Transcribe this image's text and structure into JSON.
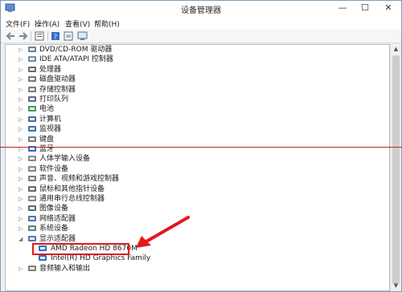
{
  "window": {
    "title": "设备管理器",
    "minimize": "—",
    "maximize": "☐",
    "close": "✕"
  },
  "menu": {
    "items": [
      {
        "label": "文件(F)"
      },
      {
        "label": "操作(A)"
      },
      {
        "label": "查看(V)"
      },
      {
        "label": "帮助(H)"
      }
    ]
  },
  "toolbar": {
    "icons": [
      "back-icon",
      "forward-icon",
      "properties-icon",
      "help-icon",
      "view-icon",
      "monitor-icon"
    ]
  },
  "tree": {
    "items": [
      {
        "label": "DVD/CD-ROM 驱动器",
        "expander": "▷",
        "icon": "dvd-drive-icon"
      },
      {
        "label": "IDE ATA/ATAPI 控制器",
        "expander": "▷",
        "icon": "ide-controller-icon"
      },
      {
        "label": "处理器",
        "expander": "▷",
        "icon": "processor-icon"
      },
      {
        "label": "磁盘驱动器",
        "expander": "▷",
        "icon": "disk-drive-icon"
      },
      {
        "label": "存储控制器",
        "expander": "▷",
        "icon": "storage-controller-icon"
      },
      {
        "label": "打印队列",
        "expander": "▷",
        "icon": "printer-icon"
      },
      {
        "label": "电池",
        "expander": "▷",
        "icon": "battery-icon"
      },
      {
        "label": "计算机",
        "expander": "▷",
        "icon": "computer-icon"
      },
      {
        "label": "监视器",
        "expander": "▷",
        "icon": "monitor-icon"
      },
      {
        "label": "键盘",
        "expander": "▷",
        "icon": "keyboard-icon"
      },
      {
        "label": "蓝牙",
        "expander": "▷",
        "icon": "bluetooth-icon"
      },
      {
        "label": "人体学输入设备",
        "expander": "▷",
        "icon": "hid-icon"
      },
      {
        "label": "软件设备",
        "expander": "▷",
        "icon": "software-device-icon"
      },
      {
        "label": "声音、视频和游戏控制器",
        "expander": "▷",
        "icon": "sound-icon"
      },
      {
        "label": "鼠标和其他指针设备",
        "expander": "▷",
        "icon": "mouse-icon"
      },
      {
        "label": "通用串行总线控制器",
        "expander": "▷",
        "icon": "usb-icon"
      },
      {
        "label": "图像设备",
        "expander": "▷",
        "icon": "camera-icon"
      },
      {
        "label": "网络适配器",
        "expander": "▷",
        "icon": "network-adapter-icon"
      },
      {
        "label": "系统设备",
        "expander": "▷",
        "icon": "system-device-icon"
      },
      {
        "label": "显示适配器",
        "expander": "◢",
        "icon": "display-adapter-icon"
      },
      {
        "label": "AMD Radeon HD 8670M",
        "expander": "",
        "icon": "display-card-icon"
      },
      {
        "label": "Intel(R) HD Graphics Family",
        "expander": "",
        "icon": "display-card-icon"
      },
      {
        "label": "音频输入和输出",
        "expander": "▷",
        "icon": "audio-io-icon"
      }
    ]
  },
  "colors": {
    "annotation_red": "#e3191c",
    "divider_red": "#c0262d"
  }
}
